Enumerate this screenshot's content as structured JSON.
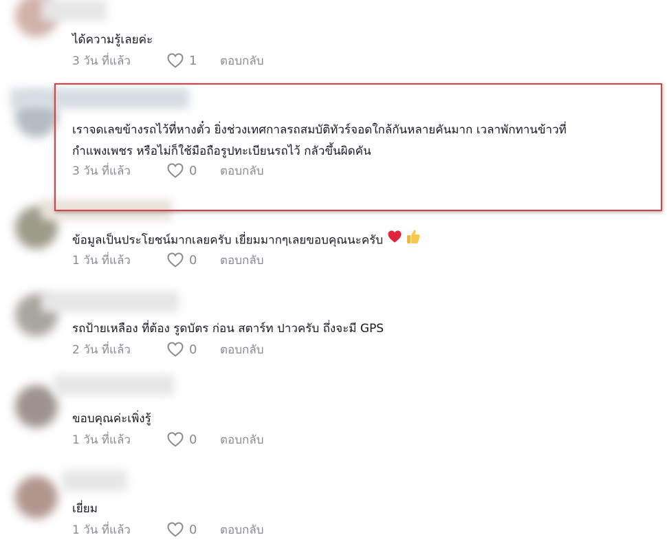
{
  "comments": [
    {
      "text_lines": [
        "ได้ความรู้เลยค่ะ"
      ],
      "time": "3 วัน ที่แล้ว",
      "likes": "1",
      "reply": "ตอบกลับ"
    },
    {
      "text_lines": [
        "เราจดเลขข้างรถไว้ที่หางตั๋ว ยิ่งช่วงเทศกาลรถสมบัติทัวร์จอดใกล้กันหลายคันมาก เวลาพักทานข้าวที่",
        "กำแพงเพชร หรือไม่ก็ใช้มือถือรูปทะเบียนรถไว้ กลัวขึ้นผิดคัน"
      ],
      "time": "3 วัน ที่แล้ว",
      "likes": "0",
      "reply": "ตอบกลับ"
    },
    {
      "text_lines": [
        "ข้อมูลเป็นประโยชน์มากเลยครับ เยี่ยมมากๆเลยขอบคุณนะครับ"
      ],
      "emojis": [
        "red-heart",
        "thumbs-up"
      ],
      "time": "1 วัน ที่แล้ว",
      "likes": "0",
      "reply": "ตอบกลับ"
    },
    {
      "text_lines": [
        "รถป้ายเหลือง ที่ต้อง รูดบัตร ก่อน สตาร์ท ปาวครับ ถึ่งจะมี GPS"
      ],
      "time": "2 วัน ที่แล้ว",
      "likes": "0",
      "reply": "ตอบกลับ"
    },
    {
      "text_lines": [
        "ขอบคุณค่ะเพิ่งรู้"
      ],
      "time": "1 วัน ที่แล้ว",
      "likes": "0",
      "reply": "ตอบกลับ"
    },
    {
      "text_lines": [
        "เยี่ยม"
      ],
      "time": "1 วัน ที่แล้ว",
      "likes": "0",
      "reply": "ตอบกลับ"
    }
  ],
  "colors": {
    "text": "#161823",
    "meta": "#8a8b91",
    "highlight_border": "#e23b3f"
  }
}
